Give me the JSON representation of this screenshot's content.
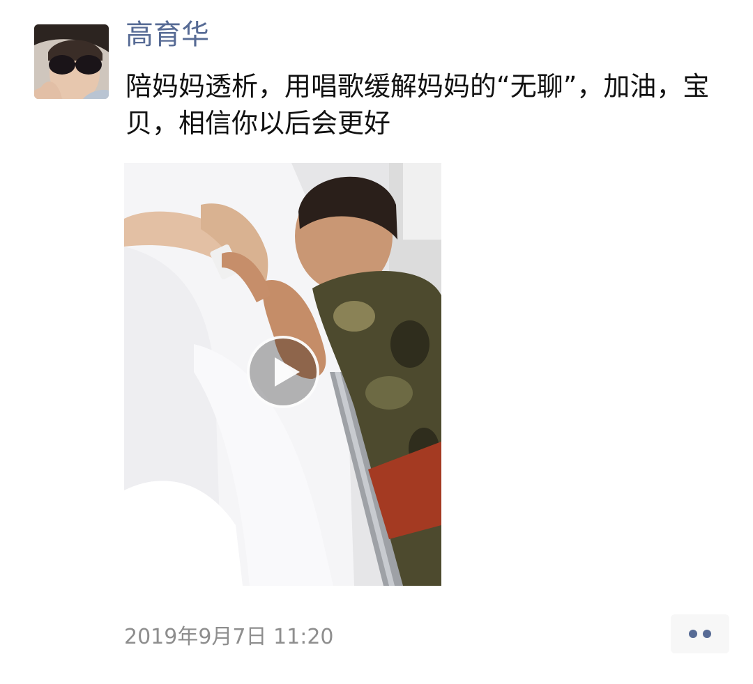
{
  "post": {
    "author": {
      "name": "高育华",
      "avatar_icon": "avatar-photo"
    },
    "text": "陪妈妈透析，用唱歌缓解妈妈的“无聊”，加油，宝贝，相信你以后会更好",
    "media": {
      "type": "video",
      "play_icon": "play-icon"
    },
    "timestamp": "2019年9月7日 11:20",
    "actions": {
      "more_icon": "more-dots-icon"
    }
  },
  "colors": {
    "nickname": "#576b95",
    "body_text": "#111111",
    "timestamp": "#8e8e8e",
    "background": "#ffffff"
  }
}
